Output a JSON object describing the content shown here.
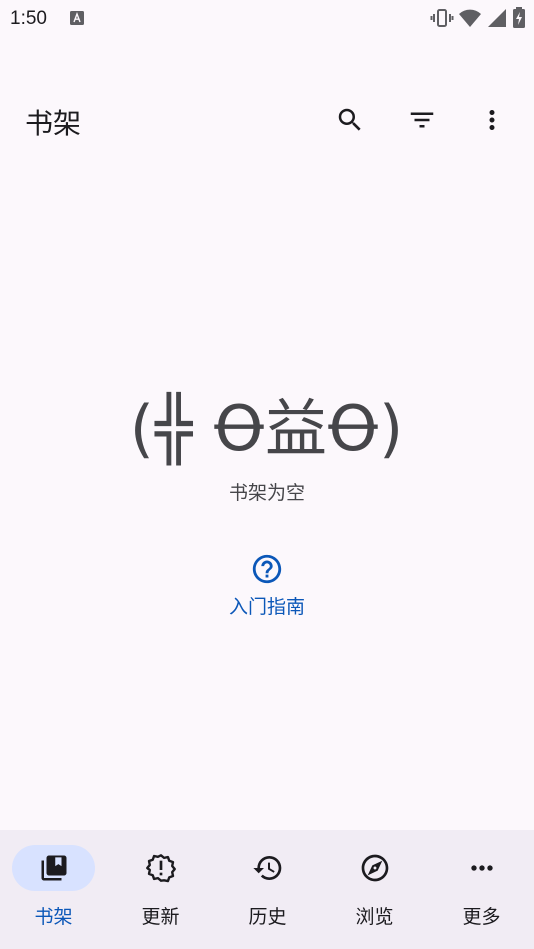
{
  "status_bar": {
    "time": "1:50"
  },
  "header": {
    "title": "书架",
    "actions": [
      {
        "name": "search",
        "icon": "search-icon"
      },
      {
        "name": "filter",
        "icon": "filter-icon"
      },
      {
        "name": "more",
        "icon": "more-vert-icon"
      }
    ]
  },
  "empty_state": {
    "face": "(╬ Ꝋ益Ꝋ)",
    "message": "书架为空",
    "guide_label": "入门指南",
    "guide_icon": "help-circle-icon"
  },
  "bottom_nav": {
    "items": [
      {
        "label": "书架",
        "icon": "library-icon",
        "active": true
      },
      {
        "label": "更新",
        "icon": "new-releases-icon",
        "active": false
      },
      {
        "label": "历史",
        "icon": "history-icon",
        "active": false
      },
      {
        "label": "浏览",
        "icon": "explore-icon",
        "active": false
      },
      {
        "label": "更多",
        "icon": "more-horiz-icon",
        "active": false
      }
    ]
  },
  "colors": {
    "background": "#fcf8fc",
    "accent": "#0b57b8",
    "nav_background": "#f1ecf4",
    "active_pill": "#d8e2ff"
  }
}
